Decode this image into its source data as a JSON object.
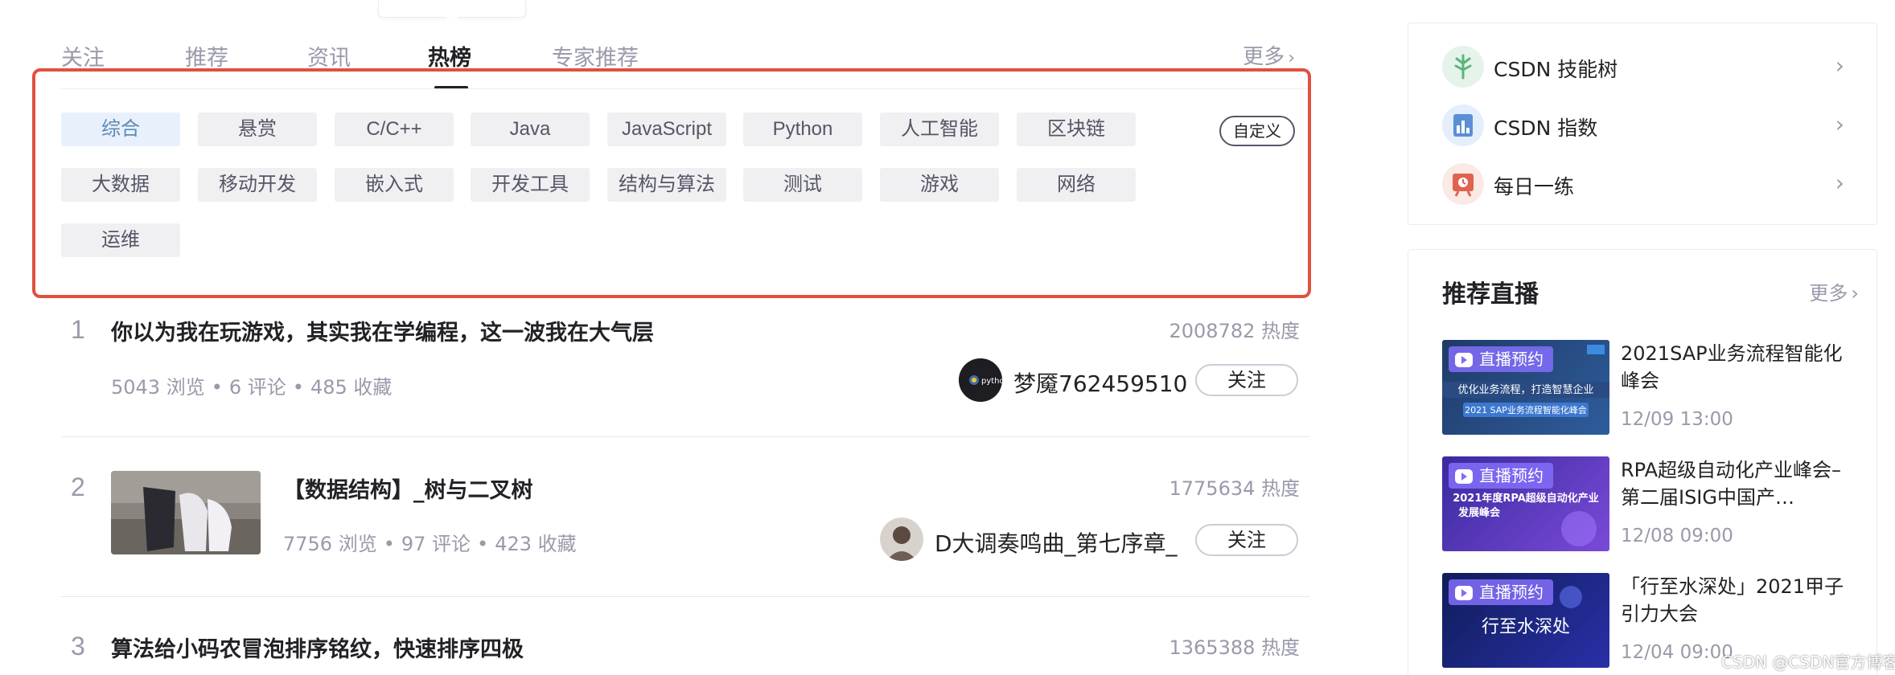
{
  "tabs": {
    "items": [
      {
        "label": "关注"
      },
      {
        "label": "推荐"
      },
      {
        "label": "资讯"
      },
      {
        "label": "热榜"
      },
      {
        "label": "专家推荐"
      }
    ],
    "active": "热榜",
    "more_label": "更多"
  },
  "tags": {
    "row1": [
      "综合",
      "悬赏",
      "C/C++",
      "Java",
      "JavaScript",
      "Python",
      "人工智能",
      "区块链"
    ],
    "row2": [
      "大数据",
      "移动开发",
      "嵌入式",
      "开发工具",
      "结构与算法",
      "测试",
      "游戏",
      "网络"
    ],
    "row3": [
      "运维"
    ],
    "selected": "综合",
    "custom_label": "自定义"
  },
  "hot_list": [
    {
      "rank": "1",
      "title": "你以为我在玩游戏，其实我在学编程，这一波我在大气层",
      "views": "5043 浏览",
      "comments": "6 评论",
      "favorites": "485 收藏",
      "heat": "2008782 热度",
      "author": "梦魇762459510",
      "avatar_text": "python",
      "follow_label": "关注"
    },
    {
      "rank": "2",
      "title": "【数据结构】_树与二叉树",
      "views": "7756 浏览",
      "comments": "97 评论",
      "favorites": "423 收藏",
      "heat": "1775634 热度",
      "author": "D大调奏鸣曲_第七序章_",
      "follow_label": "关注"
    },
    {
      "rank": "3",
      "title": "算法给小码农冒泡排序铭纹，快速排序四极",
      "heat": "1365388 热度"
    }
  ],
  "sidebar": {
    "links": [
      {
        "label": "CSDN 技能树",
        "icon": "tree-icon",
        "color": "#5fb37d"
      },
      {
        "label": "CSDN 指数",
        "icon": "chart-index-icon",
        "color": "#5b8fd6"
      },
      {
        "label": "每日一练",
        "icon": "clock-board-icon",
        "color": "#e0634f"
      }
    ],
    "live": {
      "title": "推荐直播",
      "more_label": "更多",
      "badge_label": "直播预约",
      "items": [
        {
          "title": "2021SAP业务流程智能化峰会",
          "time": "12/09 13:00",
          "poster_line1": "优化业务流程，打造智慧企业",
          "poster_line2": "2021 SAP业务流程智能化峰会"
        },
        {
          "title": "RPA超级自动化产业峰会–第二届ISIG中国产…",
          "time": "12/08 09:00",
          "poster_line1": "2021年度RPA超级自动化产业",
          "poster_line2": "发展峰会"
        },
        {
          "title": "「行至水深处」2021甲子引力大会",
          "time": "12/04 09:00",
          "poster_line1": "行至水深处"
        }
      ]
    }
  },
  "watermark": "CSDN @CSDN官方博客",
  "colors": {
    "accent_red": "#e0513f",
    "selected_tag_bg": "#e8f1fb",
    "live_badge": "#826efa"
  }
}
